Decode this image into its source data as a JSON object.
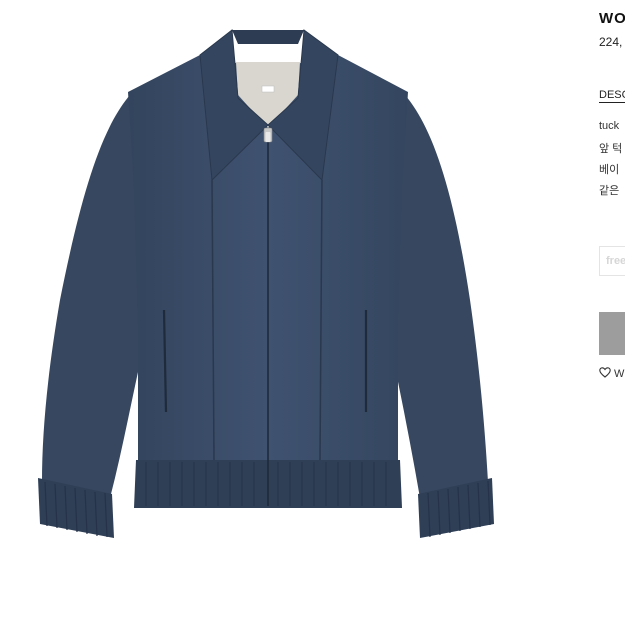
{
  "product": {
    "title": "WO",
    "price": "224,",
    "image_icon": "jacket-photo"
  },
  "tabs": {
    "description": "DESC"
  },
  "description_lines": [
    "tuck",
    "앞 턱",
    "베이",
    "같은"
  ],
  "option": {
    "label": "free",
    "icon": "size-option"
  },
  "wishlist": {
    "label": "W",
    "icon": "heart-icon"
  },
  "colors": {
    "jacket": "#3a4c66",
    "buy_button": "#9d9d9d",
    "option_border": "#e4e4e4"
  }
}
